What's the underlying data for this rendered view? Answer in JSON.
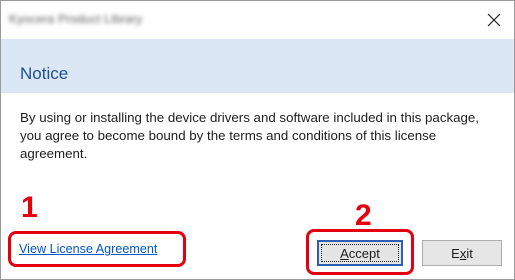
{
  "window": {
    "title": "Kyocera Product Library",
    "close_icon": "close-icon"
  },
  "dialog": {
    "heading": "Notice",
    "message": "By using or installing the device drivers and software included in this package, you agree to become bound by the terms and conditions of this license agreement."
  },
  "annotations": {
    "step1": "1",
    "step2": "2",
    "highlight_color": "#e4000f"
  },
  "links": {
    "license": "View License Agreement"
  },
  "buttons": {
    "accept": {
      "mnemonic": "A",
      "rest": "ccept"
    },
    "exit": {
      "before": "E",
      "mnemonic": "x",
      "rest": "it"
    }
  },
  "colors": {
    "header_band": "#dce7f5",
    "heading": "#1f4e96",
    "link": "#0058c7"
  }
}
